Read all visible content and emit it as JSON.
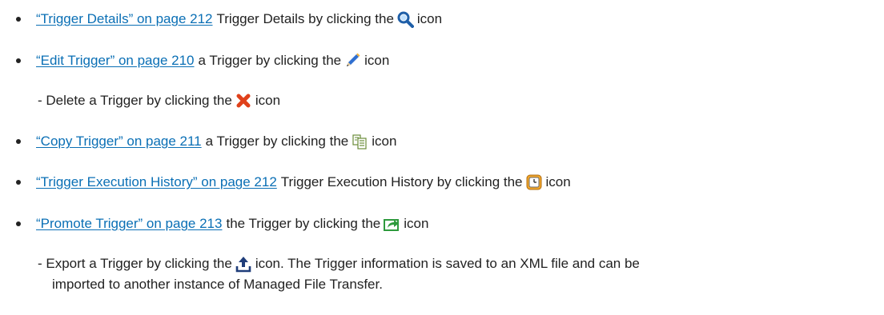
{
  "items": [
    {
      "link": "“Trigger Details” on page 212",
      "text": "Trigger Details by clicking the",
      "icon": "magnifier-icon",
      "after": "icon"
    },
    {
      "link": "“Edit Trigger” on page 210",
      "text": "a Trigger by clicking the",
      "icon": "pencil-icon",
      "after": "icon"
    },
    {
      "sub": "- Delete a Trigger by clicking the",
      "icon": "red-x-icon",
      "after": "icon"
    },
    {
      "link": "“Copy Trigger” on page 211",
      "text": "a Trigger by clicking the",
      "icon": "copy-document-icon",
      "after": "icon"
    },
    {
      "link": "“Trigger Execution History” on page 212",
      "text": "Trigger Execution History by clicking the",
      "icon": "history-icon",
      "after": "icon"
    },
    {
      "link": "“Promote Trigger” on page 213",
      "text": "the Trigger by clicking the",
      "icon": "promote-icon",
      "after": "icon"
    },
    {
      "sub": "- Export a Trigger by clicking the",
      "icon": "export-upload-icon",
      "after": "icon. The Trigger information is saved to an XML file and can be",
      "continuation": "imported to another instance of Managed File Transfer."
    }
  ],
  "colors": {
    "link": "#0a6fb5",
    "text": "#222222"
  }
}
